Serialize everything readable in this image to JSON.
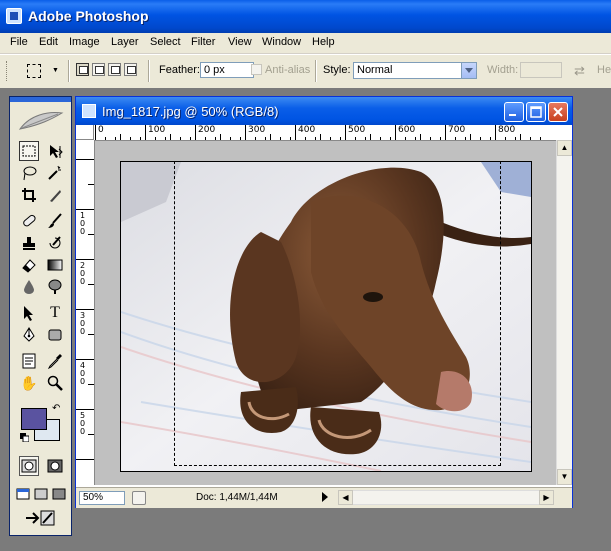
{
  "app": {
    "title": "Adobe Photoshop"
  },
  "menu": {
    "items": [
      "File",
      "Edit",
      "Image",
      "Layer",
      "Select",
      "Filter",
      "View",
      "Window",
      "Help"
    ]
  },
  "options": {
    "feather_label": "Feather:",
    "feather_value": "0 px",
    "antialias_label": "Anti-alias",
    "style_label": "Style:",
    "style_value": "Normal",
    "width_label": "Width:",
    "height_label_partial": "He"
  },
  "document": {
    "title": "Img_1817.jpg @ 50% (RGB/8)",
    "zoom": "50%",
    "doc_info": "Doc: 1,44M/1,44M"
  },
  "ruler": {
    "x_ticks": [
      "0",
      "100",
      "200",
      "300",
      "400",
      "500",
      "600",
      "700",
      "800"
    ],
    "y_ticks": [
      "1\n0\n0",
      "2\n0\n0",
      "3\n0\n0",
      "4\n0\n0",
      "5\n0\n0"
    ]
  },
  "colors": {
    "foreground": "#5a53a0",
    "background": "#dfe8f1",
    "title_blue": "#0054e3"
  },
  "icons": {
    "tools": [
      "marquee-tool-icon",
      "move-tool-icon",
      "lasso-tool-icon",
      "magic-wand-icon",
      "crop-tool-icon",
      "slice-tool-icon",
      "healing-brush-icon",
      "brush-tool-icon",
      "clone-stamp-icon",
      "history-brush-icon",
      "eraser-tool-icon",
      "gradient-tool-icon",
      "blur-tool-icon",
      "dodge-tool-icon",
      "path-selection-icon",
      "type-tool-icon",
      "pen-tool-icon",
      "shape-tool-icon",
      "notes-tool-icon",
      "eyedropper-icon",
      "hand-tool-icon",
      "zoom-tool-icon"
    ]
  }
}
